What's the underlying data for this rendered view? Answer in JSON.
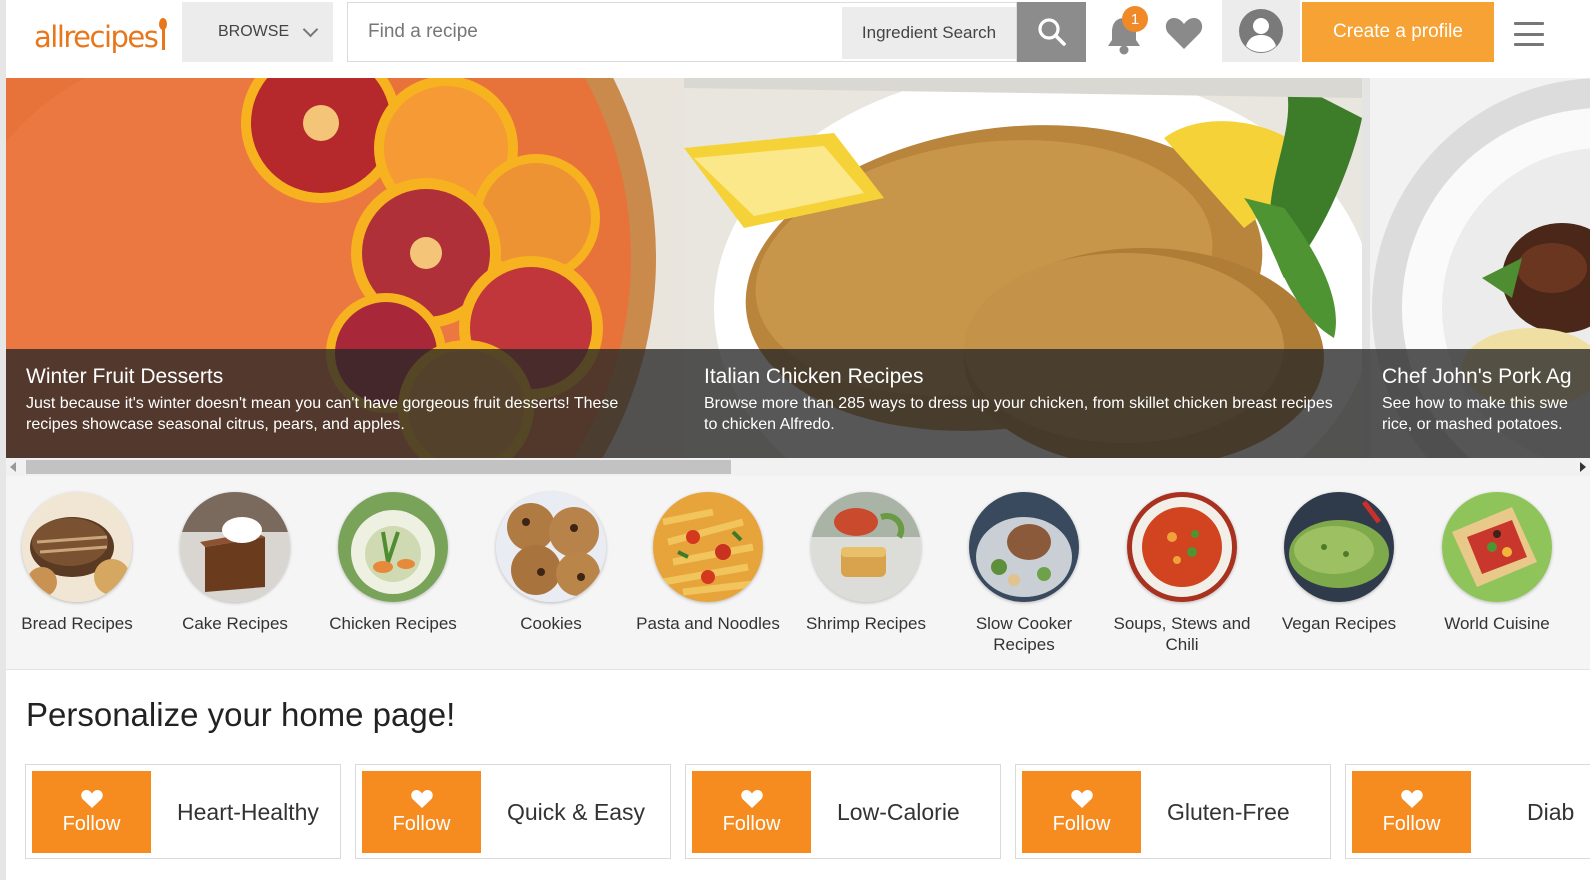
{
  "header": {
    "logo_text": "allrecipes",
    "browse_label": "BROWSE",
    "search_placeholder": "Find a recipe",
    "ingredient_search_label": "Ingredient Search",
    "notification_count": "1",
    "create_profile_label": "Create a profile",
    "icons": [
      "search-icon",
      "bell-icon",
      "heart-icon",
      "user-icon",
      "hamburger-menu-icon",
      "chevron-down-icon"
    ]
  },
  "carousel": {
    "slides": [
      {
        "title": "Winter Fruit Desserts",
        "description": "Just because it's winter doesn't mean you can't have gorgeous fruit desserts! These recipes showcase seasonal citrus, pears, and apples."
      },
      {
        "title": "Italian Chicken Recipes",
        "description": "Browse more than 285 ways to dress up your chicken, from skillet chicken breast recipes to chicken Alfredo."
      },
      {
        "title": "Chef John's Pork Ag",
        "description": "See how to make this swe rice, or mashed potatoes."
      }
    ]
  },
  "categories": [
    {
      "label": "Bread Recipes"
    },
    {
      "label": "Cake Recipes"
    },
    {
      "label": "Chicken Recipes"
    },
    {
      "label": "Cookies"
    },
    {
      "label": "Pasta and Noodles"
    },
    {
      "label": "Shrimp Recipes"
    },
    {
      "label": "Slow Cooker Recipes"
    },
    {
      "label": "Soups, Stews and Chili"
    },
    {
      "label": "Vegan Recipes"
    },
    {
      "label": "World Cuisine"
    }
  ],
  "personalize": {
    "title": "Personalize your home page!",
    "follow_label": "Follow",
    "topics": [
      {
        "label": "Heart-Healthy"
      },
      {
        "label": "Quick & Easy"
      },
      {
        "label": "Low-Calorie"
      },
      {
        "label": "Gluten-Free"
      },
      {
        "label": "Diab"
      }
    ]
  },
  "colors": {
    "brand_orange": "#e8771c",
    "follow_orange": "#f68b1f",
    "create_profile_bg": "#f7a234",
    "search_button_bg": "#8c8c8c"
  }
}
